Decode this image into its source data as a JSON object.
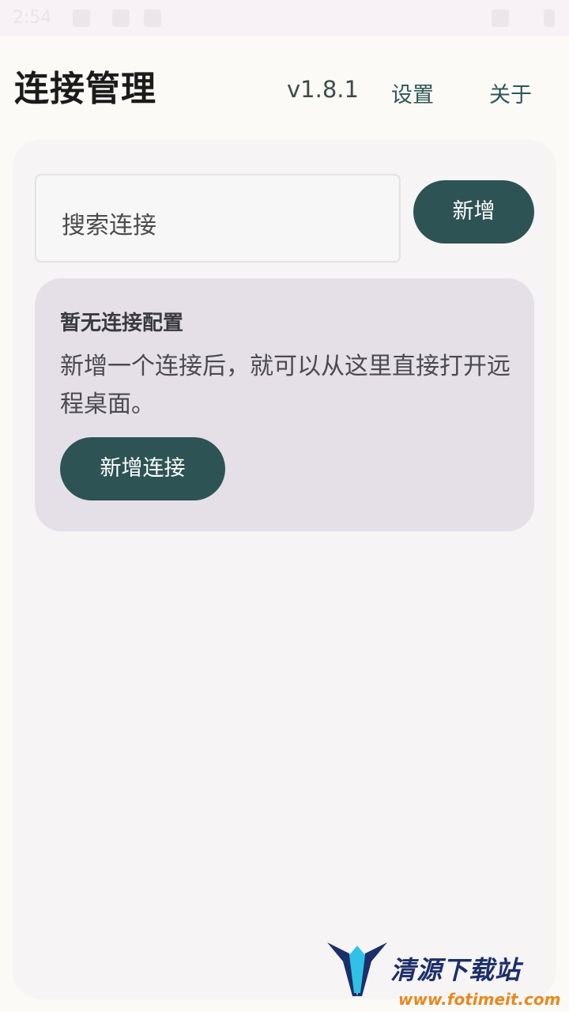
{
  "status_bar": {
    "time": "2:54"
  },
  "header": {
    "title": "连接管理",
    "version": "v1.8.1",
    "settings_label": "设置",
    "about_label": "关于"
  },
  "search": {
    "placeholder": "搜索连接"
  },
  "toolbar": {
    "add_label": "新增"
  },
  "empty_state": {
    "title": "暂无连接配置",
    "description": "新增一个连接后，就可以从这里直接打开远程桌面。",
    "button_label": "新增连接"
  },
  "watermark": {
    "brand": "清源下载站",
    "url": "www.fotimeit.com"
  },
  "colors": {
    "accent": "#2e5354",
    "card_bg": "#e5e0e8",
    "panel_bg": "#f6f4f5"
  }
}
